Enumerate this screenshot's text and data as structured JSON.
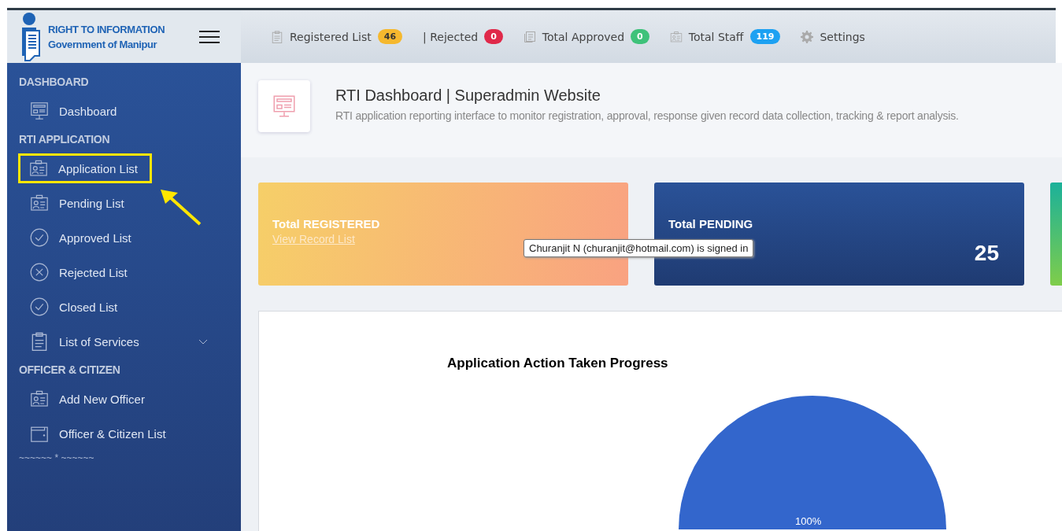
{
  "logo": {
    "line_1": "RIGHT TO INFORMATION",
    "line_2": "Government of Manipur"
  },
  "top_nav": [
    {
      "kind": "clipboard",
      "label": "Registered List",
      "badge": "46",
      "color": "#f5b82e"
    },
    {
      "kind": "plain",
      "label": "| Rejected",
      "badge": "0",
      "color": "#e0294a"
    },
    {
      "kind": "document",
      "label": "Total Approved",
      "badge": "0",
      "color": "#3ec27a"
    },
    {
      "kind": "idcard",
      "label": "Total Staff",
      "badge": "119",
      "color": "#1da1f2"
    },
    {
      "kind": "gear",
      "label": "Settings"
    }
  ],
  "sidebar": {
    "sections": [
      {
        "heading": "DASHBOARD",
        "items": [
          {
            "kind": "monitor",
            "label": "Dashboard",
            "expandable": false,
            "highlighted": false
          }
        ]
      },
      {
        "heading": "RTI APPLICATION",
        "items": [
          {
            "kind": "idcard",
            "label": "Application List",
            "expandable": false,
            "highlighted": true
          },
          {
            "kind": "idcard",
            "label": "Pending List",
            "expandable": false,
            "highlighted": false
          },
          {
            "kind": "check",
            "label": "Approved List",
            "expandable": false,
            "highlighted": false
          },
          {
            "kind": "cross",
            "label": "Rejected List",
            "expandable": false,
            "highlighted": false
          },
          {
            "kind": "check",
            "label": "Closed List",
            "expandable": false,
            "highlighted": false
          },
          {
            "kind": "clipboard",
            "label": "List of Services",
            "expandable": true,
            "highlighted": false
          }
        ]
      },
      {
        "heading": "OFFICER & CITIZEN",
        "items": [
          {
            "kind": "idcard",
            "label": "Add New Officer",
            "expandable": false,
            "highlighted": false
          },
          {
            "kind": "wallet",
            "label": "Officer & Citizen List",
            "expandable": false,
            "highlighted": false
          }
        ]
      }
    ],
    "footer": "~~~~~~ * ~~~~~~"
  },
  "page_header": {
    "title": "RTI Dashboard | Superadmin Website",
    "subtitle": "RTI application reporting interface to monitor registration, approval, response given record data collection, tracking & report analysis."
  },
  "stat_cards": [
    {
      "kind": "warm",
      "title": "Total REGISTERED",
      "link": "View Record List"
    },
    {
      "kind": "navy",
      "title": "Total PENDING",
      "value": "25"
    },
    {
      "kind": "green"
    }
  ],
  "tooltip": "Churanjit N (churanjit@hotmail.com) is signed in",
  "chart": {
    "title": "Application Action Taken Progress",
    "slice_label": "100%"
  }
}
